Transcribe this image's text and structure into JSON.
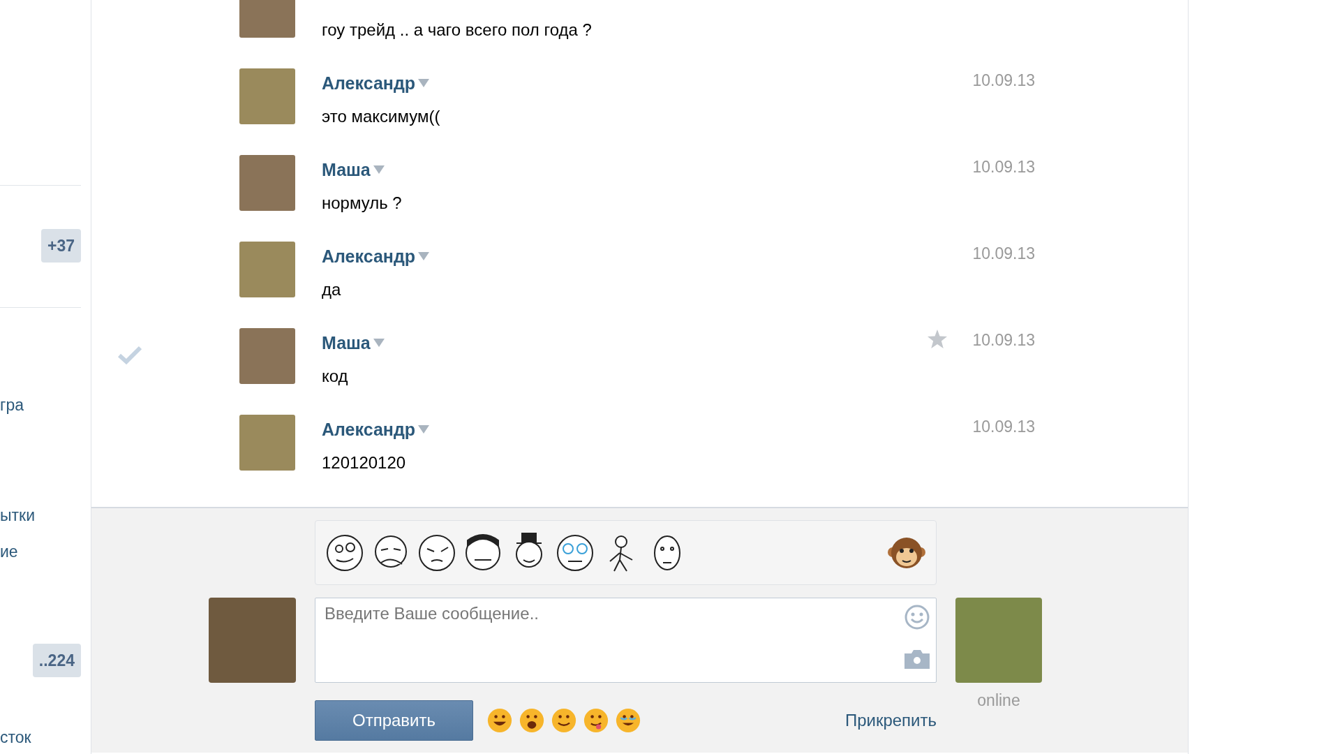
{
  "sidebar": {
    "items": [
      {
        "kind": "divider"
      },
      {
        "kind": "badge",
        "label": "+37"
      },
      {
        "kind": "divider"
      },
      {
        "kind": "link",
        "label": "гра"
      },
      {
        "kind": "link",
        "label": "ытки"
      },
      {
        "kind": "link",
        "label": "ие"
      },
      {
        "kind": "badge",
        "label": "..224"
      },
      {
        "kind": "link",
        "label": "сток"
      }
    ]
  },
  "messages": [
    {
      "text": "гоу трейд .. а чаго всего пол года ?",
      "starred": false,
      "checked": false
    },
    {
      "author": "Александр",
      "date": "10.09.13",
      "text": "это максимум((",
      "starred": false,
      "checked": false
    },
    {
      "author": "Маша",
      "date": "10.09.13",
      "text": "нормуль ?",
      "starred": false,
      "checked": false
    },
    {
      "author": "Александр",
      "date": "10.09.13",
      "text": "да",
      "starred": false,
      "checked": false
    },
    {
      "author": "Маша",
      "date": "10.09.13",
      "text": "код",
      "starred": true,
      "checked": true
    },
    {
      "author": "Александр",
      "date": "10.09.13",
      "text": "120120120",
      "starred": false,
      "checked": false
    }
  ],
  "composer": {
    "placeholder": "Введите Ваше сообщение..",
    "send_button": "Отправить",
    "attach_link": "Прикрепить",
    "status": "online"
  }
}
